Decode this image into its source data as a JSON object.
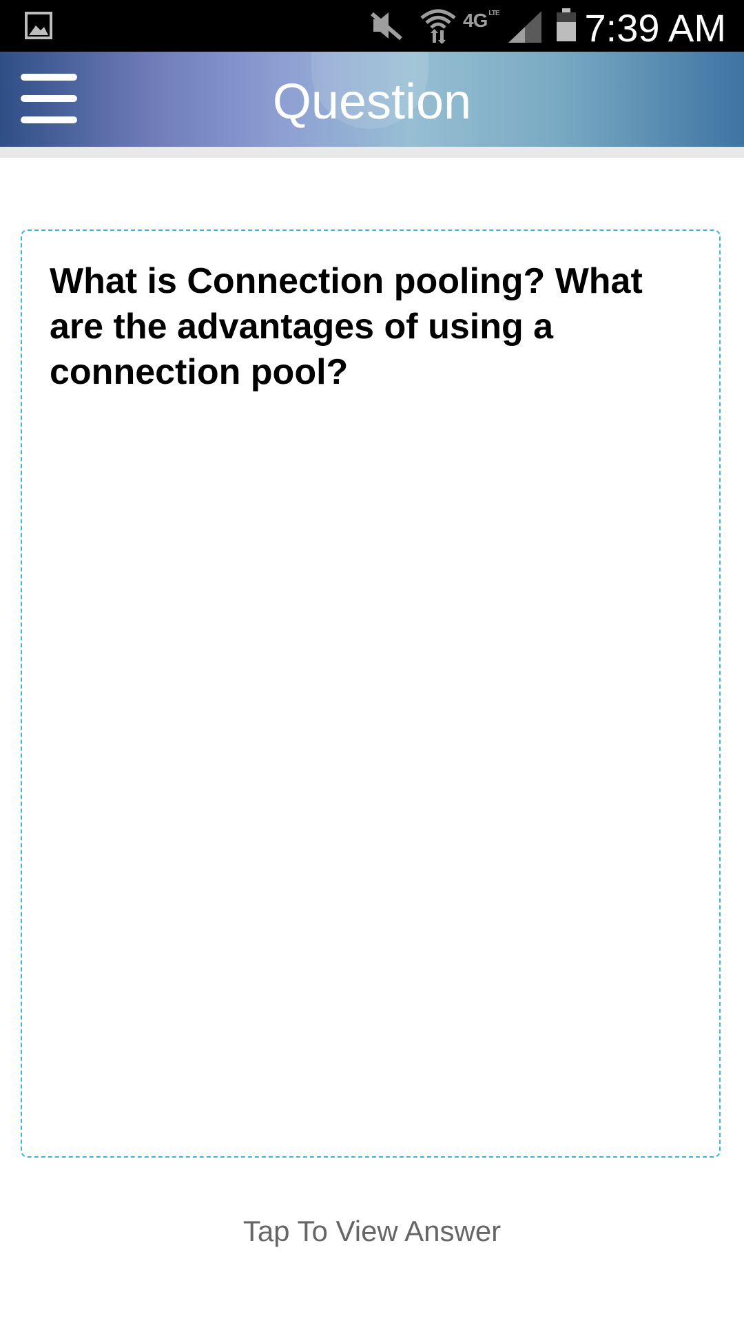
{
  "status_bar": {
    "network": "4G",
    "network_sub": "LTE",
    "time": "7:39 AM"
  },
  "app_bar": {
    "title": "Question"
  },
  "card": {
    "question": "What is Connection pooling? What are the advantages of using a connection pool?"
  },
  "footer": {
    "tap_label": "Tap To View Answer"
  },
  "colors": {
    "accent_dashed_border": "#3fb3d8",
    "status_bar_bg": "#000000",
    "footer_text": "#666666"
  },
  "icons": [
    "gallery-icon",
    "mute-icon",
    "wifi-icon",
    "signal-icon",
    "battery-icon",
    "menu-icon"
  ]
}
